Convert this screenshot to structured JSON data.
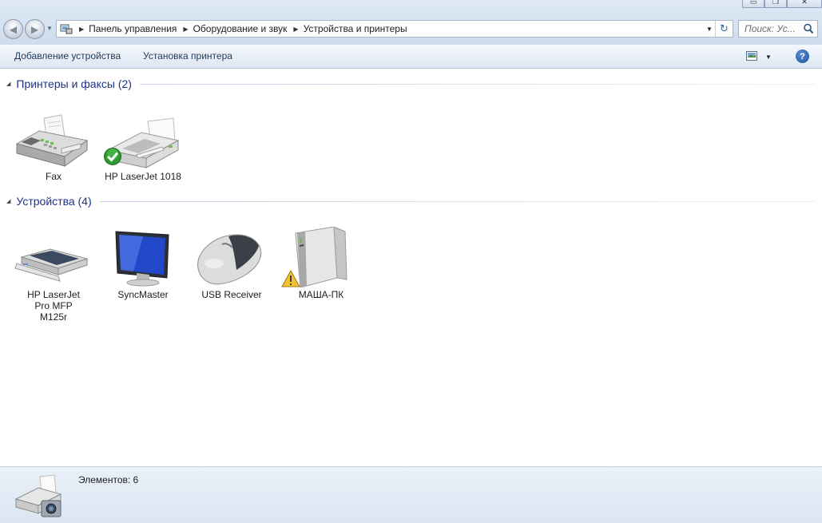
{
  "window": {
    "minimize_glyph": "▭",
    "maximize_glyph": "❐",
    "close_glyph": "✕"
  },
  "nav": {
    "back_glyph": "◀",
    "forward_glyph": "▶",
    "history_glyph": "▼"
  },
  "address": {
    "crumbs": [
      "Панель управления",
      "Оборудование и звук",
      "Устройства и принтеры"
    ],
    "separator_glyph": "▶",
    "dropdown_glyph": "▼",
    "refresh_glyph": "↻"
  },
  "search": {
    "placeholder": "Поиск: Ус..."
  },
  "commandbar": {
    "add_device": "Добавление устройства",
    "add_printer": "Установка принтера",
    "view_dropdown_glyph": "▼",
    "help_glyph": "?"
  },
  "groups": [
    {
      "title": "Принтеры и факсы (2)",
      "collapse_glyph": "◢",
      "items": [
        {
          "name": "Fax",
          "icon": "fax-icon"
        },
        {
          "name": "HP LaserJet 1018",
          "icon": "printer-icon",
          "badge": "default-check-icon"
        }
      ]
    },
    {
      "title": "Устройства (4)",
      "collapse_glyph": "◢",
      "items": [
        {
          "name": "HP LaserJet Pro MFP M125r",
          "icon": "scanner-icon"
        },
        {
          "name": "SyncMaster",
          "icon": "monitor-icon"
        },
        {
          "name": "USB Receiver",
          "icon": "mouse-icon"
        },
        {
          "name": "МАША-ПК",
          "icon": "computer-icon",
          "badge": "warning-icon"
        }
      ]
    }
  ],
  "details": {
    "count": "Элементов: 6",
    "icon": "devices-and-printers-icon"
  },
  "colors": {
    "group_title": "#1e3287",
    "command_text": "#1e395b",
    "default_badge": "#2e9a2e",
    "warning_badge": "#f2c230"
  }
}
